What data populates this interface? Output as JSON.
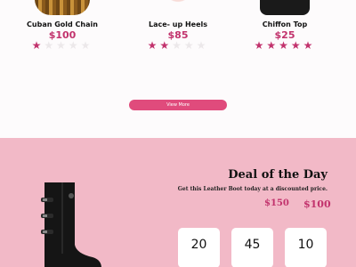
{
  "products": [
    {
      "name": "Cuban Gold Chain",
      "price": "$100",
      "rating": 1,
      "max_rating": 5,
      "image_icon": "gold-chain-image"
    },
    {
      "name": "Lace- up Heels",
      "price": "$85",
      "rating": 2,
      "max_rating": 5,
      "image_icon": "heels-image"
    },
    {
      "name": "Chiffon Top",
      "price": "$25",
      "rating": 5,
      "max_rating": 5,
      "image_icon": "chiffon-top-image"
    }
  ],
  "view_more_label": "View More",
  "deal": {
    "title": "Deal of the Day",
    "subtitle": "Get this Leather Boot today at a discounted price.",
    "old_price": "$150",
    "new_price": "$100",
    "image_icon": "leather-boot-image",
    "countdown": [
      "20",
      "45",
      "10"
    ]
  },
  "colors": {
    "accent": "#c2336d",
    "button": "#e04b7c",
    "deal_bg": "#f2b9c7",
    "star_empty": "#ece8ea"
  }
}
